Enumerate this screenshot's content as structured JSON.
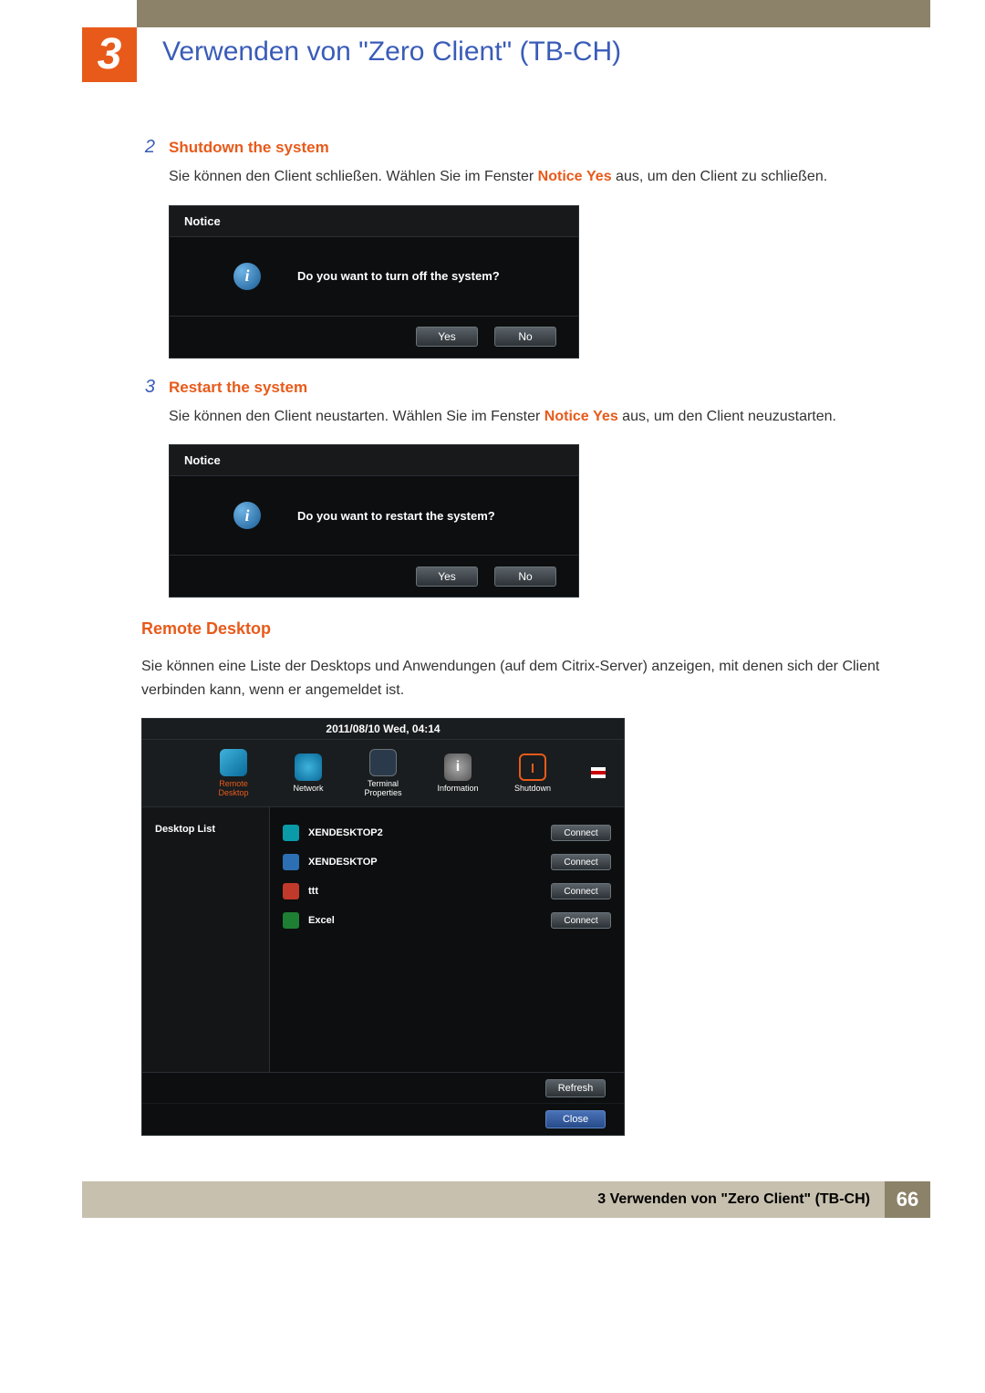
{
  "chapter": {
    "number": "3",
    "title": "Verwenden von \"Zero Client\" (TB-CH)"
  },
  "steps": [
    {
      "num": "2",
      "heading": "Shutdown the system",
      "body_pre": "Sie können den Client schließen. Wählen Sie im Fenster ",
      "body_hl1": "Notice",
      "body_mid": " ",
      "body_hl2": "Yes",
      "body_post": " aus, um den Client zu schließen.",
      "dialog": {
        "title": "Notice",
        "message": "Do you want to turn off the system?",
        "yes": "Yes",
        "no": "No"
      }
    },
    {
      "num": "3",
      "heading": "Restart the system",
      "body_pre": "Sie können den Client neustarten. Wählen Sie im Fenster ",
      "body_hl1": "Notice",
      "body_mid": " ",
      "body_hl2": "Yes",
      "body_post": " aus, um den Client neuzustarten.",
      "dialog": {
        "title": "Notice",
        "message": "Do you want to restart the system?",
        "yes": "Yes",
        "no": "No"
      }
    }
  ],
  "remote": {
    "heading": "Remote Desktop",
    "body": "Sie können eine Liste der Desktops und Anwendungen (auf dem Citrix-Server) anzeigen, mit denen sich der Client verbinden kann, wenn er angemeldet ist.",
    "datetime": "2011/08/10 Wed, 04:14",
    "toolbar": {
      "remote_desktop": "Remote Desktop",
      "network": "Network",
      "terminal_properties": "Terminal Properties",
      "information": "Information",
      "shutdown": "Shutdown"
    },
    "side_label": "Desktop List",
    "connect_label": "Connect",
    "rows": [
      {
        "name": "XENDESKTOP2"
      },
      {
        "name": "XENDESKTOP"
      },
      {
        "name": "ttt"
      },
      {
        "name": "Excel"
      }
    ],
    "refresh": "Refresh",
    "close": "Close"
  },
  "footer": {
    "text": "3 Verwenden von \"Zero Client\" (TB-CH)",
    "page": "66"
  }
}
